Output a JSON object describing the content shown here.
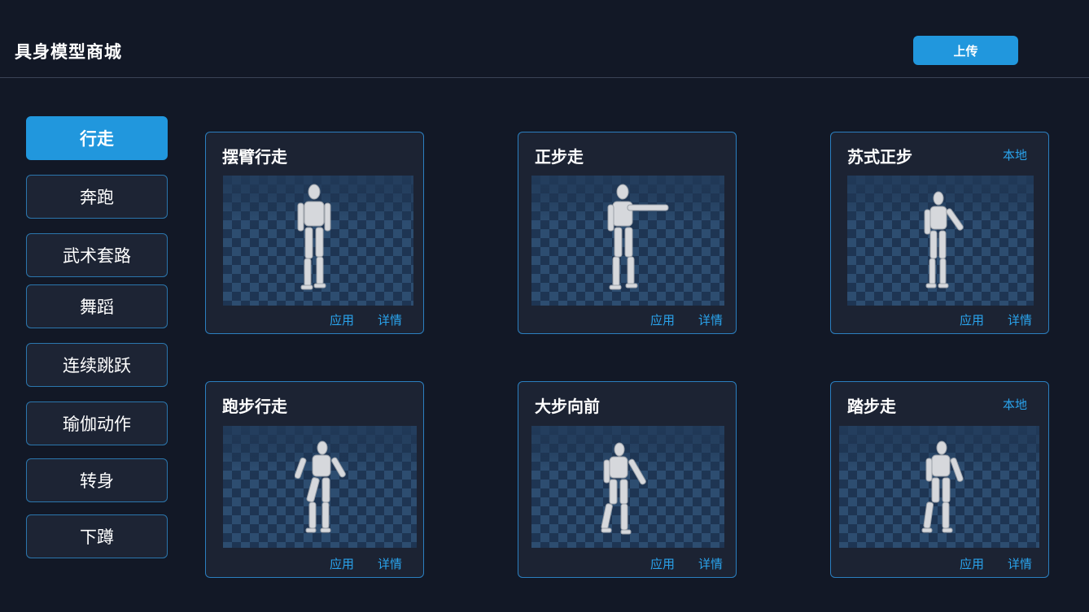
{
  "header": {
    "title": "具身模型商城",
    "upload_label": "上传"
  },
  "sidebar": {
    "items": [
      {
        "label": "行走",
        "active": true
      },
      {
        "label": "奔跑"
      },
      {
        "label": "武术套路"
      },
      {
        "label": "舞蹈"
      },
      {
        "label": "连续跳跃"
      },
      {
        "label": "瑜伽动作"
      },
      {
        "label": "转身"
      },
      {
        "label": "下蹲"
      }
    ]
  },
  "cards": [
    {
      "title": "摆臂行走",
      "badge": "",
      "apply": "应用",
      "details": "详情"
    },
    {
      "title": "正步走",
      "badge": "",
      "apply": "应用",
      "details": "详情"
    },
    {
      "title": "苏式正步",
      "badge": "本地",
      "apply": "应用",
      "details": "详情"
    },
    {
      "title": "跑步行走",
      "badge": "",
      "apply": "应用",
      "details": "详情"
    },
    {
      "title": "大步向前",
      "badge": "",
      "apply": "应用",
      "details": "详情"
    },
    {
      "title": "踏步走",
      "badge": "本地",
      "apply": "应用",
      "details": "详情"
    }
  ],
  "colors": {
    "background": "#121826",
    "accent": "#2197dd",
    "link": "#2aa3ec",
    "card_border": "#2b7fc0",
    "floor_light": "#2d4d70",
    "floor_dark": "#1e3553"
  },
  "icons": {
    "robot": "humanoid-robot-icon"
  }
}
